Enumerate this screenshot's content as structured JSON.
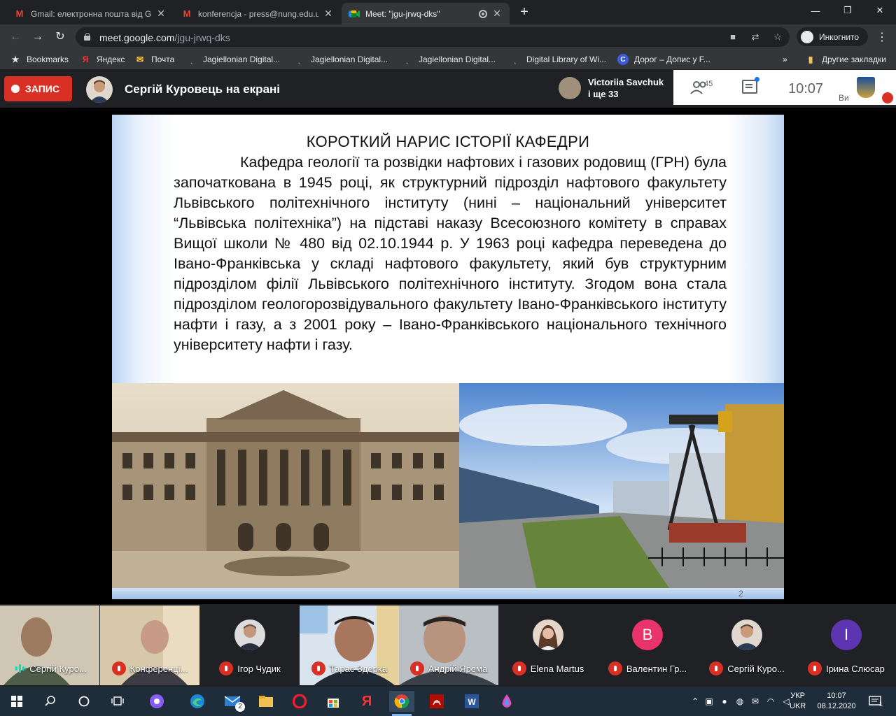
{
  "browser": {
    "tabs": [
      {
        "title": "Gmail: електронна пошта від Go",
        "icon": "gmail-icon"
      },
      {
        "title": "konferencja - press@nung.edu.u",
        "icon": "gmail-icon"
      },
      {
        "title": "Meet: \"jgu-jrwq-dks\"",
        "icon": "meet-icon",
        "active": true
      }
    ],
    "url_host": "meet.google.com",
    "url_path": "/jgu-jrwq-dks",
    "incognito_label": "Инкогнито",
    "bookmarks": [
      {
        "label": "Bookmarks",
        "icon": "star-icon"
      },
      {
        "label": "Яндекс",
        "icon": "yandex-icon"
      },
      {
        "label": "Почта",
        "icon": "mail-icon"
      },
      {
        "label": "Jagiellonian Digital...",
        "icon": "jdl-icon"
      },
      {
        "label": "Jagiellonian Digital...",
        "icon": "jdl-icon"
      },
      {
        "label": "Jagiellonian Digital...",
        "icon": "jdl-icon"
      },
      {
        "label": "Digital Library of Wi...",
        "icon": "jdl-icon"
      },
      {
        "label": "Дорог – Допис у F...",
        "icon": "c-icon"
      }
    ],
    "bookmarks_more": "»",
    "other_bookmarks": "Другие закладки"
  },
  "meet": {
    "record_label": "ЗАПИС",
    "presenter_title": "Сергій Куровець на екрані",
    "others_name": "Victoriia Savchuk",
    "others_more": "і ще 33",
    "people_count": "45",
    "time": "10:07",
    "self_label": "Ви"
  },
  "slide": {
    "title": "КОРОТКИЙ НАРИС ІСТОРІЇ КАФЕДРИ",
    "body": "Кафедра геології та розвідки нафтових і газових родовищ (ГРН) була започаткована в 1945 році, як структурний підрозділ нафтового факультету Львівського політехнічного інституту (нині – національний університет “Львівська політехніка”) на підставі наказу Всесоюзного комітету в справах Вищої школи № 480 від 02.10.1944 р. У 1963 році кафедра переведена до Івано-Франківська у складі нафтового факультету, який був структурним підрозділом філії Львівського політехнічного інституту. Згодом вона стала підрозділом геологорозвідувального факультету Івано-Франківського інституту нафти і газу, а з 2001 року – Івано-Франківського національного технічного університету нафти і газу.",
    "page_number": "2"
  },
  "participants": [
    {
      "name": "Сергій Куро...",
      "kind": "video",
      "speaking": true
    },
    {
      "name": "Конференці...",
      "kind": "video",
      "muted": true
    },
    {
      "name": "Ігор Чудик",
      "kind": "photo",
      "muted": true
    },
    {
      "name": "Тарас Здерка",
      "kind": "video",
      "muted": true
    },
    {
      "name": "Андрій Ярема",
      "kind": "video",
      "muted": true
    },
    {
      "name": "Elena Martus",
      "kind": "photo",
      "muted": true
    },
    {
      "name": "Валентин Гр...",
      "kind": "letter",
      "letter": "В",
      "color": "#e8336b",
      "muted": true
    },
    {
      "name": "Сергій Куро...",
      "kind": "photo",
      "muted": true
    },
    {
      "name": "Ірина Слюсар",
      "kind": "letter",
      "letter": "І",
      "color": "#5e35b1",
      "muted": true
    }
  ],
  "taskbar": {
    "apps": [
      "windows-start-icon",
      "search-icon",
      "cortana-icon",
      "task-view-icon",
      "assistant-icon",
      "edge-icon",
      "mail-icon",
      "file-explorer-icon",
      "opera-icon",
      "store-icon",
      "yandex-icon",
      "chrome-icon",
      "acrobat-icon",
      "word-icon",
      "ink-icon"
    ],
    "mail_badge": "2",
    "lang_top": "УКР",
    "lang_bottom": "UKR",
    "clock_time": "10:07",
    "clock_date": "08.12.2020",
    "notif_count": "1"
  }
}
